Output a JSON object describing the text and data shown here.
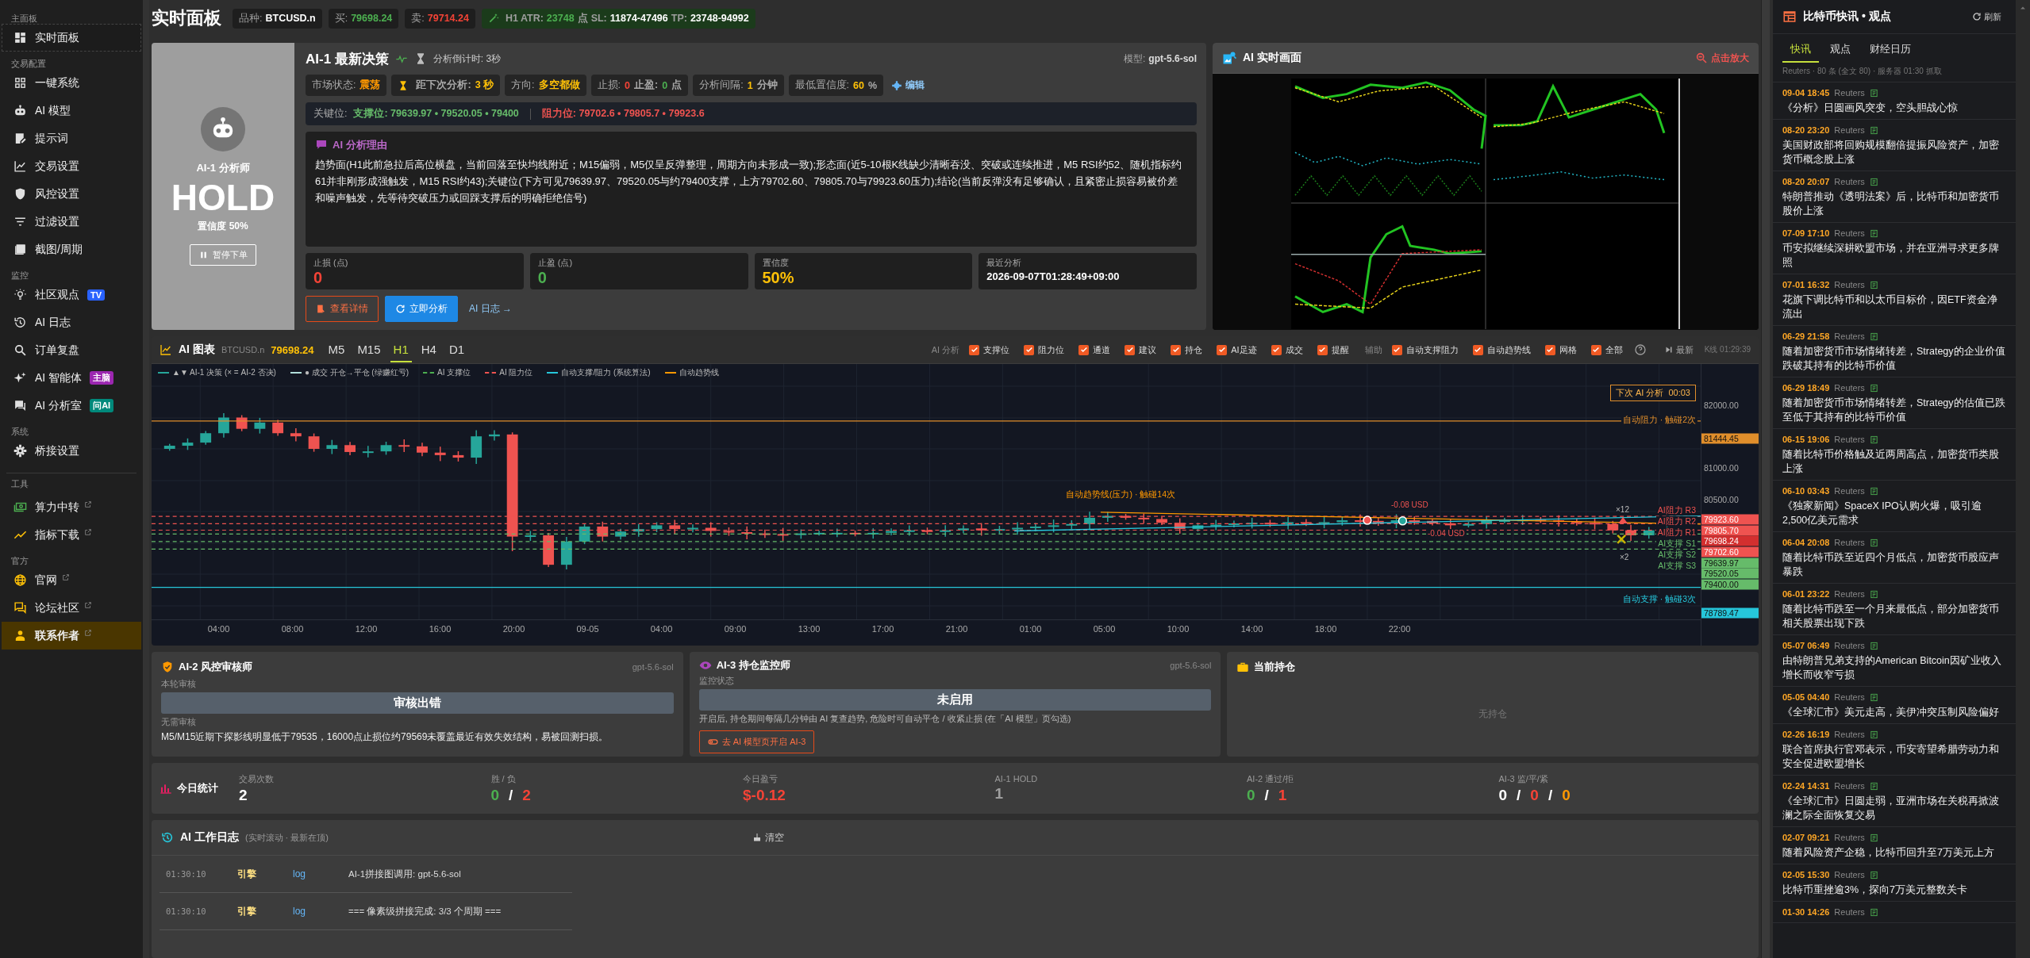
{
  "sidebar": {
    "sections": [
      {
        "label": "主面板",
        "separated": false,
        "items": [
          {
            "label": "实时面板",
            "selected": true,
            "highlighted": false,
            "external": false
          }
        ]
      },
      {
        "label": "交易配置",
        "separated": false,
        "items": [
          {
            "label": "一键系统",
            "selected": false,
            "highlighted": false,
            "external": false
          },
          {
            "label": "AI 模型",
            "selected": false,
            "highlighted": false,
            "external": false
          },
          {
            "label": "提示词",
            "selected": false,
            "highlighted": false,
            "external": false
          },
          {
            "label": "交易设置",
            "selected": false,
            "highlighted": false,
            "external": false
          },
          {
            "label": "风控设置",
            "selected": false,
            "highlighted": false,
            "external": false
          },
          {
            "label": "过滤设置",
            "selected": false,
            "highlighted": false,
            "external": false
          },
          {
            "label": "截图/周期",
            "selected": false,
            "highlighted": false,
            "external": false
          }
        ]
      },
      {
        "label": "监控",
        "separated": false,
        "items": [
          {
            "label": "社区观点",
            "selected": false,
            "highlighted": false,
            "external": false,
            "badge": {
              "text": "TV",
              "color": "#2962ff"
            }
          },
          {
            "label": "AI 日志",
            "selected": false,
            "highlighted": false,
            "external": false
          },
          {
            "label": "订单复盘",
            "selected": false,
            "highlighted": false,
            "external": false
          },
          {
            "label": "AI 智能体",
            "selected": false,
            "highlighted": false,
            "external": false,
            "badge": {
              "text": "主脑",
              "color": "#9c27b0"
            }
          },
          {
            "label": "AI 分析室",
            "selected": false,
            "highlighted": false,
            "external": false,
            "badge": {
              "text": "问AI",
              "color": "#00897b"
            }
          }
        ]
      },
      {
        "label": "系统",
        "separated": false,
        "items": [
          {
            "label": "桥接设置",
            "selected": false,
            "highlighted": false,
            "external": false
          }
        ]
      },
      {
        "label": "工具",
        "separated": true,
        "items": [
          {
            "label": "算力中转",
            "selected": false,
            "highlighted": false,
            "external": true
          },
          {
            "label": "指标下载",
            "selected": false,
            "highlighted": false,
            "external": true
          }
        ]
      },
      {
        "label": "官方",
        "separated": false,
        "items": [
          {
            "label": "官网",
            "selected": false,
            "highlighted": false,
            "external": true
          },
          {
            "label": "论坛社区",
            "selected": false,
            "highlighted": false,
            "external": true
          },
          {
            "label": "联系作者",
            "selected": false,
            "highlighted": true,
            "external": true
          }
        ]
      }
    ]
  },
  "topbar": {
    "title": "实时面板",
    "chips": [
      {
        "kind": "plain",
        "parts": [
          {
            "text": "品种:",
            "color": "#9e9e9e"
          },
          {
            "text": "BTCUSD.n",
            "color": "#ffffff"
          }
        ]
      },
      {
        "kind": "plain",
        "parts": [
          {
            "text": "买:",
            "color": "#9e9e9e"
          },
          {
            "text": "79698.24",
            "color": "#4caf50"
          }
        ]
      },
      {
        "kind": "plain",
        "parts": [
          {
            "text": "卖:",
            "color": "#9e9e9e"
          },
          {
            "text": "79714.24",
            "color": "#f44336"
          }
        ]
      },
      {
        "kind": "atr",
        "parts": [
          {
            "text": "H1 ATR:",
            "color": "#9e9e9e"
          },
          {
            "text": "23748",
            "color": "#4caf50"
          },
          {
            "text": "点",
            "color": "#9e9e9e"
          },
          {
            "text": "SL:",
            "color": "#9e9e9e"
          },
          {
            "text": "11874-47496",
            "color": "#ffffff"
          },
          {
            "text": "TP:",
            "color": "#9e9e9e"
          },
          {
            "text": "23748-94992",
            "color": "#ffffff"
          }
        ]
      }
    ]
  },
  "analyst": {
    "name": "AI-1 分析师",
    "action": "HOLD",
    "confidence": "置信度 50%",
    "pause_button": "暂停下单"
  },
  "decision": {
    "title": "AI-1 最新决策",
    "countdown": "分析倒计时: 3秒",
    "model_label": "模型:",
    "model": "gpt-5.6-sol",
    "chips": [
      {
        "kind": "plain",
        "parts": [
          {
            "text": "市场状态:",
            "color": "#aaaaaa"
          },
          {
            "text": "震荡",
            "color": "#ff9800"
          }
        ]
      },
      {
        "kind": "timer",
        "parts": [
          {
            "text": "距下次分析:",
            "color": "#aaaaaa"
          },
          {
            "text": "3 秒",
            "color": "#ffc107"
          }
        ]
      },
      {
        "kind": "plain",
        "parts": [
          {
            "text": "方向:",
            "color": "#aaaaaa"
          },
          {
            "text": "多空都做",
            "color": "#ffc107"
          }
        ]
      },
      {
        "kind": "plain",
        "parts": [
          {
            "text": "止损:",
            "color": "#aaaaaa"
          },
          {
            "text": "0",
            "color": "#f44336"
          },
          {
            "text": "止盈:",
            "color": "#aaaaaa"
          },
          {
            "text": "0",
            "color": "#4caf50"
          },
          {
            "text": "点",
            "color": "#aaaaaa"
          }
        ]
      },
      {
        "kind": "plain",
        "parts": [
          {
            "text": "分析间隔:",
            "color": "#aaaaaa"
          },
          {
            "text": "1",
            "color": "#ffc107"
          },
          {
            "text": "分钟",
            "color": "#aaaaaa"
          }
        ]
      },
      {
        "kind": "plain",
        "parts": [
          {
            "text": "最低置信度:",
            "color": "#aaaaaa"
          },
          {
            "text": "60",
            "color": "#ffc107"
          },
          {
            "text": "%",
            "color": "#aaaaaa"
          }
        ]
      }
    ],
    "edit_link": "编辑",
    "key_levels": {
      "label": "关键位:",
      "support": "支撑位: 79639.97 • 79520.05 • 79400",
      "resistance": "阻力位: 79702.6 • 79805.7 • 79923.6"
    },
    "reason": {
      "title": "AI 分析理由",
      "text": "趋势面(H1此前急拉后高位横盘，当前回落至快均线附近；M15偏弱，M5仅呈反弹整理，周期方向未形成一致);形态面(近5-10根K线缺少清晰吞没、突破或连续推进，M5 RSI约52、随机指标约61并非刚形成强触发，M15 RSI约43);关键位(下方可见79639.97、79520.05与约79400支撑，上方79702.60、79805.70与79923.60压力);结论(当前反弹没有足够确认，且紧密止损容易被价差和噪声触发，先等待突破压力或回踩支撑后的明确拒绝信号)"
    },
    "stats": [
      {
        "label": "止损 (点)",
        "value": "0",
        "color": "#f44336"
      },
      {
        "label": "止盈 (点)",
        "value": "0",
        "color": "#4caf50"
      },
      {
        "label": "置信度",
        "value": "50%",
        "color": "#ffc107"
      },
      {
        "label": "最近分析",
        "value": "2026-09-07T01:28:49+09:00",
        "color": "#ffffff"
      }
    ],
    "actions": [
      {
        "kind": "outline",
        "label": "查看详情"
      },
      {
        "kind": "primary",
        "label": "立即分析"
      },
      {
        "kind": "link",
        "label": "AI 日志 →"
      }
    ]
  },
  "live_view": {
    "title": "AI 实时画面",
    "zoom": "点击放大"
  },
  "chart": {
    "title": "AI 图表",
    "symbol": "BTCUSD.n",
    "price": "79698.24",
    "timeframes": [
      {
        "label": "M5",
        "selected": false
      },
      {
        "label": "M15",
        "selected": false
      },
      {
        "label": "H1",
        "selected": true
      },
      {
        "label": "H4",
        "selected": false
      },
      {
        "label": "D1",
        "selected": false
      }
    ],
    "toggles_label": "AI 分析",
    "toggles": [
      {
        "label": "支撑位",
        "checked": true
      },
      {
        "label": "阻力位",
        "checked": true
      },
      {
        "label": "通道",
        "checked": true
      },
      {
        "label": "建议",
        "checked": true
      },
      {
        "label": "持仓",
        "checked": true
      },
      {
        "label": "AI足迹",
        "checked": true
      },
      {
        "label": "成交",
        "checked": true
      },
      {
        "label": "提醒",
        "checked": true
      }
    ],
    "aux_label": "辅助",
    "aux_toggles": [
      {
        "label": "自动支撑阻力",
        "checked": true
      },
      {
        "label": "自动趋势线",
        "checked": true
      },
      {
        "label": "网格",
        "checked": true
      },
      {
        "label": "全部",
        "checked": true
      }
    ],
    "latest_button": "最新",
    "kline_time": "K线 01:29:39",
    "legend": [
      {
        "kind": "solid",
        "color": "#26a69a",
        "label": "▲▼ AI-1 决策 (× = AI-2 否决)"
      },
      {
        "kind": "solid",
        "color": "#b2dfdb",
        "label": "● 成交 开仓→平仓 (绿赚红亏)"
      },
      {
        "kind": "dashed",
        "color": "#4caf50",
        "label": "AI 支撑位"
      },
      {
        "kind": "dashed",
        "color": "#ef5350",
        "label": "AI 阻力位"
      },
      {
        "kind": "solid",
        "color": "#26c6da",
        "label": "自动支撑/阻力 (系统算法)"
      },
      {
        "kind": "solid",
        "color": "#ff9800",
        "label": "自动趋势线"
      }
    ],
    "next_analysis": "下次 AI 分析  00:03",
    "line_labels": [
      {
        "kind": "auto-resistance",
        "text": "自动阻力 · 触碰2次"
      },
      {
        "kind": "trend",
        "text": "自动趋势线(压力) · 触碰14次"
      },
      {
        "kind": "resistance",
        "text": "AI阻力 R3"
      },
      {
        "kind": "resistance",
        "text": "AI阻力 R2"
      },
      {
        "kind": "resistance",
        "text": "AI阻力 R1"
      },
      {
        "kind": "support",
        "text": "AI支撑 S1"
      },
      {
        "kind": "support",
        "text": "AI支撑 S2"
      },
      {
        "kind": "support",
        "text": "AI支撑 S3"
      },
      {
        "kind": "auto-support",
        "text": "自动支撑 · 触碰3次"
      }
    ],
    "trade_labels": [
      "-0.08 USD",
      "-0.04 USD"
    ],
    "marker_labels": [
      "×12",
      "×2"
    ],
    "y_labels": [
      {
        "kind": "tick",
        "text": "82000.00"
      },
      {
        "kind": "auto-resistance",
        "text": "81444.45"
      },
      {
        "kind": "tick",
        "text": "81000.00"
      },
      {
        "kind": "tick",
        "text": "80500.00"
      },
      {
        "kind": "resistance",
        "text": "79923.60"
      },
      {
        "kind": "resistance",
        "text": "79805.70"
      },
      {
        "kind": "price",
        "text": "79698.24"
      },
      {
        "kind": "resistance",
        "text": "79702.60"
      },
      {
        "kind": "support",
        "text": "79639.97"
      },
      {
        "kind": "support",
        "text": "79520.05"
      },
      {
        "kind": "support",
        "text": "79400.00"
      },
      {
        "kind": "auto-support",
        "text": "78789.47"
      }
    ],
    "x_labels": [
      "04:00",
      "08:00",
      "12:00",
      "16:00",
      "20:00",
      "09-05",
      "04:00",
      "09:00",
      "13:00",
      "17:00",
      "21:00",
      "01:00",
      "05:00",
      "10:00",
      "14:00",
      "18:00",
      "22:00"
    ]
  },
  "reviewers": [
    {
      "kind": "risk",
      "title": "AI-2 风控审核师",
      "model": "gpt-5.6-sol",
      "status_label": "本轮审核",
      "status": "审核出错",
      "note_label": "无需审核",
      "note": "M5/M15近期下探影线明显低于79535，16000点止损位约79569未覆盖最近有效失效结构，易被回测扫损。"
    },
    {
      "kind": "monitor",
      "title": "AI-3 持仓监控师",
      "model": "gpt-5.6-sol",
      "status_label": "监控状态",
      "status": "未启用",
      "note": "开启后, 持仓期间每隔几分钟由 AI 复查趋势, 危险时可自动平仓 / 收紧止损 (在「AI 模型」页勾选)",
      "button": "去 AI 模型页开启 AI-3"
    }
  ],
  "position": {
    "title": "当前持仓",
    "empty": "无持仓"
  },
  "daily": {
    "title": "今日统计",
    "items": [
      {
        "label": "交易次数",
        "parts": [
          {
            "text": "2",
            "color": "#ffffff"
          }
        ]
      },
      {
        "label": "胜 / 负",
        "parts": [
          {
            "text": "0",
            "color": "#4caf50"
          },
          {
            "text": "/",
            "color": "#ffffff"
          },
          {
            "text": "2",
            "color": "#f44336"
          }
        ]
      },
      {
        "label": "今日盈亏",
        "parts": [
          {
            "text": "$-0.12",
            "color": "#f44336"
          }
        ]
      },
      {
        "label": "AI-1 HOLD",
        "parts": [
          {
            "text": "1",
            "color": "#9e9e9e"
          }
        ]
      },
      {
        "label": "AI-2 通过/拒",
        "parts": [
          {
            "text": "0",
            "color": "#4caf50"
          },
          {
            "text": "/",
            "color": "#ffffff"
          },
          {
            "text": "1",
            "color": "#f44336"
          }
        ]
      },
      {
        "label": "AI-3 监/平/紧",
        "parts": [
          {
            "text": "0",
            "color": "#ffffff"
          },
          {
            "text": "/",
            "color": "#ffffff"
          },
          {
            "text": "0",
            "color": "#f44336"
          },
          {
            "text": "/",
            "color": "#ffffff"
          },
          {
            "text": "0",
            "color": "#ff9800"
          }
        ]
      }
    ]
  },
  "log": {
    "title": "AI 工作日志",
    "subtitle": "(实时滚动 · 最新在顶)",
    "clear": "清空",
    "rows": [
      {
        "time": "01:30:10",
        "source": "引擎",
        "level": "log",
        "message": "AI-1拼接图调用: gpt-5.6-sol"
      },
      {
        "time": "01:30:10",
        "source": "引擎",
        "level": "log",
        "message": "=== 像素级拼接完成: 3/3 个周期 ==="
      }
    ]
  },
  "news": {
    "title": "比特币快讯 • 观点",
    "refresh": "刷新",
    "tabs": [
      {
        "label": "快讯",
        "selected": true
      },
      {
        "label": "观点",
        "selected": false
      },
      {
        "label": "财经日历",
        "selected": false
      }
    ],
    "meta": "Reuters · 80 条 (全文 80) · 服务器 01:30 抓取",
    "items": [
      {
        "time": "09-04 18:45",
        "source": "Reuters",
        "title": "《分析》日圆画风突变，空头胆战心惊"
      },
      {
        "time": "08-20 23:20",
        "source": "Reuters",
        "title": "美国财政部将回购规模翻倍提振风险资产，加密货币概念股上涨"
      },
      {
        "time": "08-20 20:07",
        "source": "Reuters",
        "title": "特朗普推动《透明法案》后，比特币和加密货币股价上涨"
      },
      {
        "time": "07-09 17:10",
        "source": "Reuters",
        "title": "币安拟继续深耕欧盟市场，并在亚洲寻求更多牌照"
      },
      {
        "time": "07-01 16:32",
        "source": "Reuters",
        "title": "花旗下调比特币和以太币目标价，因ETF资金净流出"
      },
      {
        "time": "06-29 21:58",
        "source": "Reuters",
        "title": "随着加密货币市场情绪转差，Strategy的企业价值跌破其持有的比特币价值"
      },
      {
        "time": "06-29 18:49",
        "source": "Reuters",
        "title": "随着加密货币市场情绪转差，Strategy的估值已跌至低于其持有的比特币价值"
      },
      {
        "time": "06-15 19:06",
        "source": "Reuters",
        "title": "随着比特币价格触及近两周高点，加密货币类股上涨"
      },
      {
        "time": "06-10 03:43",
        "source": "Reuters",
        "title": "《独家新闻》SpaceX IPO认购火爆，吸引逾2,500亿美元需求"
      },
      {
        "time": "06-04 20:08",
        "source": "Reuters",
        "title": "随着比特币跌至近四个月低点，加密货币股应声暴跌"
      },
      {
        "time": "06-01 23:22",
        "source": "Reuters",
        "title": "随着比特币跌至一个月来最低点，部分加密货币相关股票出现下跌"
      },
      {
        "time": "05-07 06:49",
        "source": "Reuters",
        "title": "由特朗普兄弟支持的American Bitcoin因矿业收入增长而收窄亏损"
      },
      {
        "time": "05-05 04:40",
        "source": "Reuters",
        "title": "《全球汇市》美元走高，美伊冲突压制风险偏好"
      },
      {
        "time": "02-26 16:19",
        "source": "Reuters",
        "title": "联合首席执行官邓表示，币安寄望希腊劳动力和安全促进欧盟增长"
      },
      {
        "time": "02-24 14:31",
        "source": "Reuters",
        "title": "《全球汇市》日圆走弱，亚洲市场在关税再掀波澜之际全面恢复交易"
      },
      {
        "time": "02-07 09:21",
        "source": "Reuters",
        "title": "随着风险资产企稳，比特币回升至7万美元上方"
      },
      {
        "time": "02-05 15:30",
        "source": "Reuters",
        "title": "比特币重挫逾3%，探向7万美元整数关卡"
      },
      {
        "time": "01-30 14:26",
        "source": "Reuters"
      }
    ]
  }
}
